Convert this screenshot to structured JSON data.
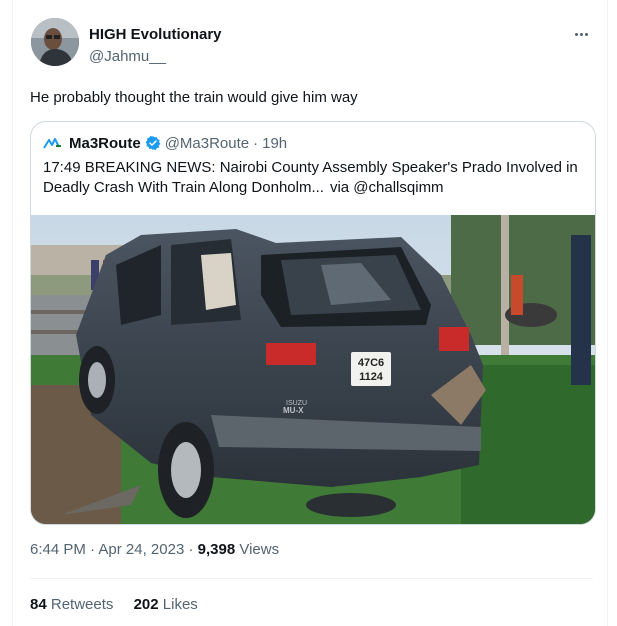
{
  "author": {
    "name": "HIGH Evolutionary",
    "handle": "@Jahmu__"
  },
  "tweet_text": "He probably thought the train would give him way",
  "quoted": {
    "name": "Ma3Route",
    "handle": "@Ma3Route",
    "separator": "·",
    "time": "19h",
    "text": "17:49 BREAKING NEWS: Nairobi County Assembly Speaker's Prado Involved in Deadly Crash With Train Along Donholm...",
    "via": "via @challsqimm",
    "image": {
      "plate_line1": "47C6",
      "plate_line2": "1124",
      "badge_line1": "ISUZU",
      "badge_line2": "MU-X"
    }
  },
  "meta": {
    "time": "6:44 PM",
    "separator1": "·",
    "date": "Apr 24, 2023",
    "separator2": "·",
    "views_count": "9,398",
    "views_label": "Views"
  },
  "stats": {
    "retweets_count": "84",
    "retweets_label": "Retweets",
    "likes_count": "202",
    "likes_label": "Likes"
  },
  "colors": {
    "verified": "#1d9bf0",
    "secondary_text": "#536471",
    "border": "#cfd9de"
  }
}
